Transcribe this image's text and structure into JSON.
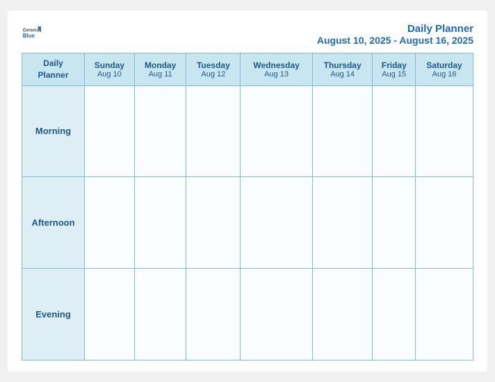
{
  "logo": {
    "general": "General",
    "blue": "Blue"
  },
  "header": {
    "title": "Daily Planner",
    "date_range": "August 10, 2025 - August 16, 2025"
  },
  "corner_label": "Daily\nPlanner",
  "columns": [
    {
      "day": "Sunday",
      "date": "Aug 10"
    },
    {
      "day": "Monday",
      "date": "Aug 11"
    },
    {
      "day": "Tuesday",
      "date": "Aug 12"
    },
    {
      "day": "Wednesday",
      "date": "Aug 13"
    },
    {
      "day": "Thursday",
      "date": "Aug 14"
    },
    {
      "day": "Friday",
      "date": "Aug 15"
    },
    {
      "day": "Saturday",
      "date": "Aug 16"
    }
  ],
  "rows": [
    {
      "label": "Morning"
    },
    {
      "label": "Afternoon"
    },
    {
      "label": "Evening"
    }
  ]
}
